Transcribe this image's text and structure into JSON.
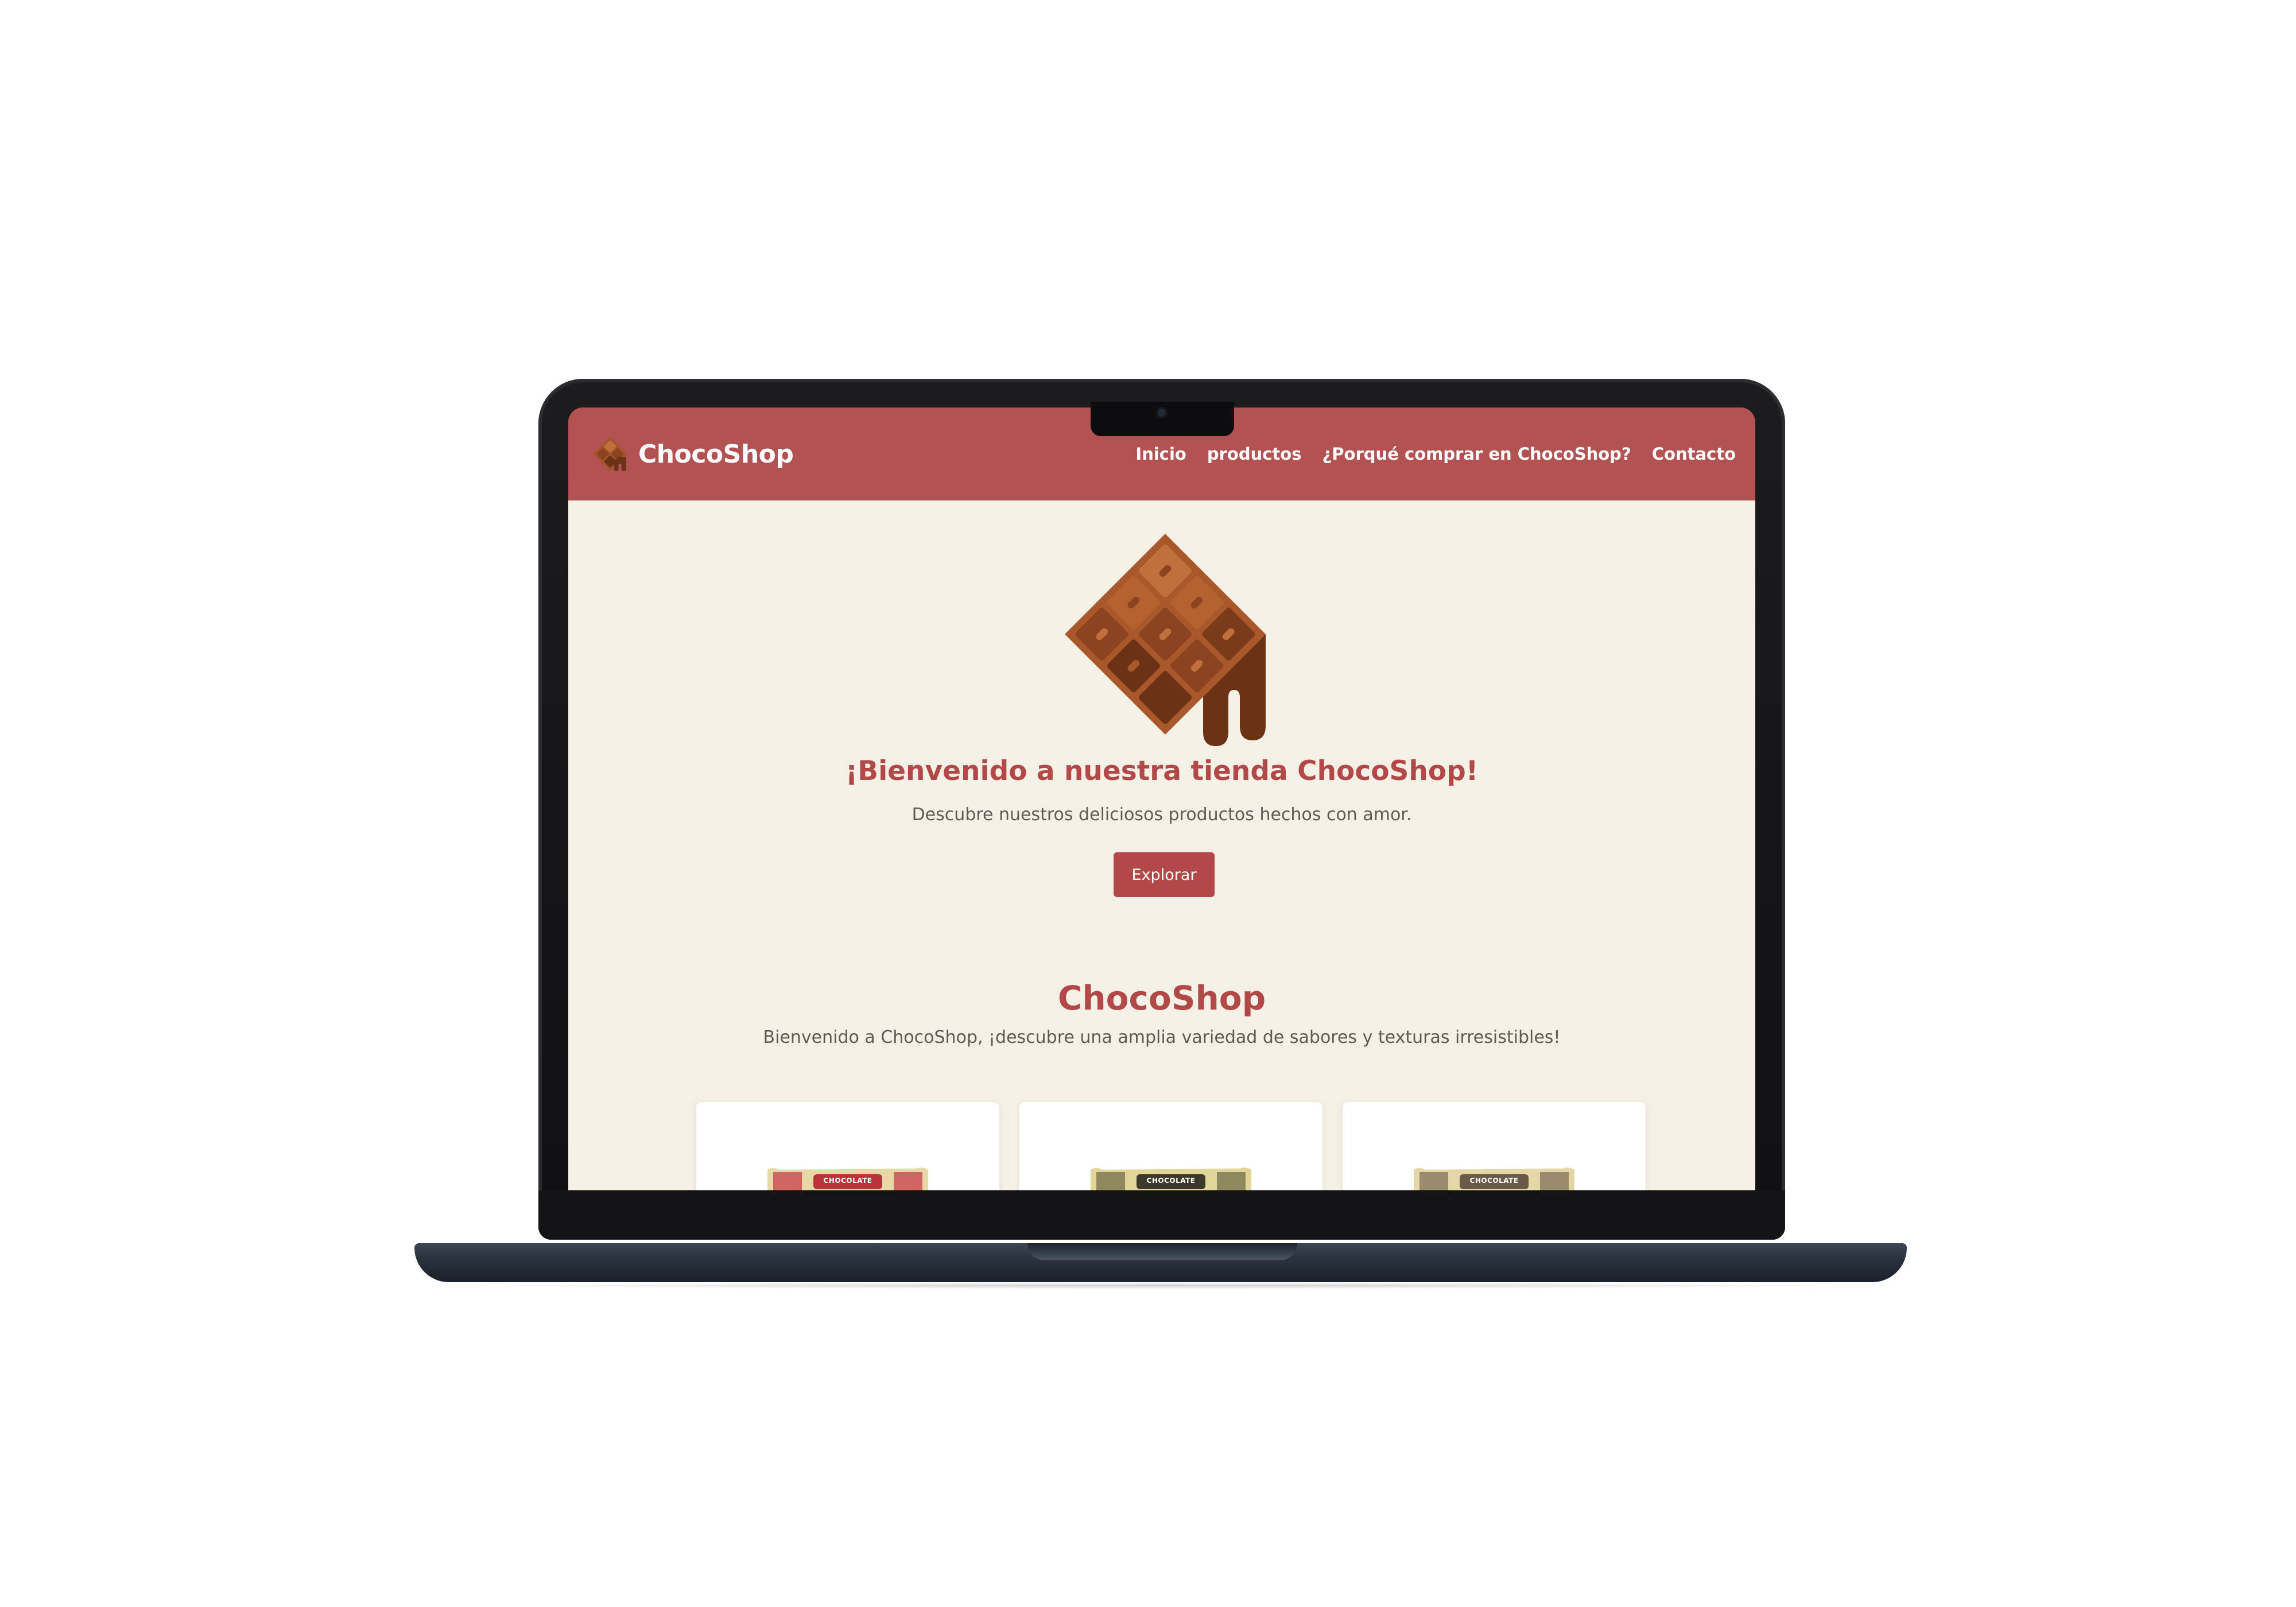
{
  "site": {
    "brand": "ChocoShop",
    "nav": [
      {
        "label": "Inicio"
      },
      {
        "label": "productos"
      },
      {
        "label": "¿Porqué comprar en ChocoShop?"
      },
      {
        "label": "Contacto"
      }
    ]
  },
  "hero": {
    "title": "¡Bienvenido a nuestra tienda ChocoShop!",
    "subtitle": "Descubre nuestros deliciosos productos hechos con amor.",
    "button_label": "Explorar"
  },
  "section": {
    "title": "ChocoShop",
    "subtitle": "Bienvenido a ChocoShop, ¡descubre una amplia variedad de sabores y texturas irresistibles!"
  },
  "products": [
    {
      "wrapper_text": "CHOCOLATE",
      "wrapper_color": "#b8333a"
    },
    {
      "wrapper_text": "CHOCOLATE",
      "wrapper_color": "#3b3a2a"
    },
    {
      "wrapper_text": "CHOCOLATE",
      "wrapper_color": "#6a5a48"
    }
  ],
  "colors": {
    "primary": "#b35252",
    "accent_text": "#b34848",
    "background": "#f4f0e6",
    "body_text": "#5f5a55"
  },
  "icons": {
    "brand_logo": "chocolate-bar-icon",
    "hero": "melting-chocolate-bar-icon"
  }
}
